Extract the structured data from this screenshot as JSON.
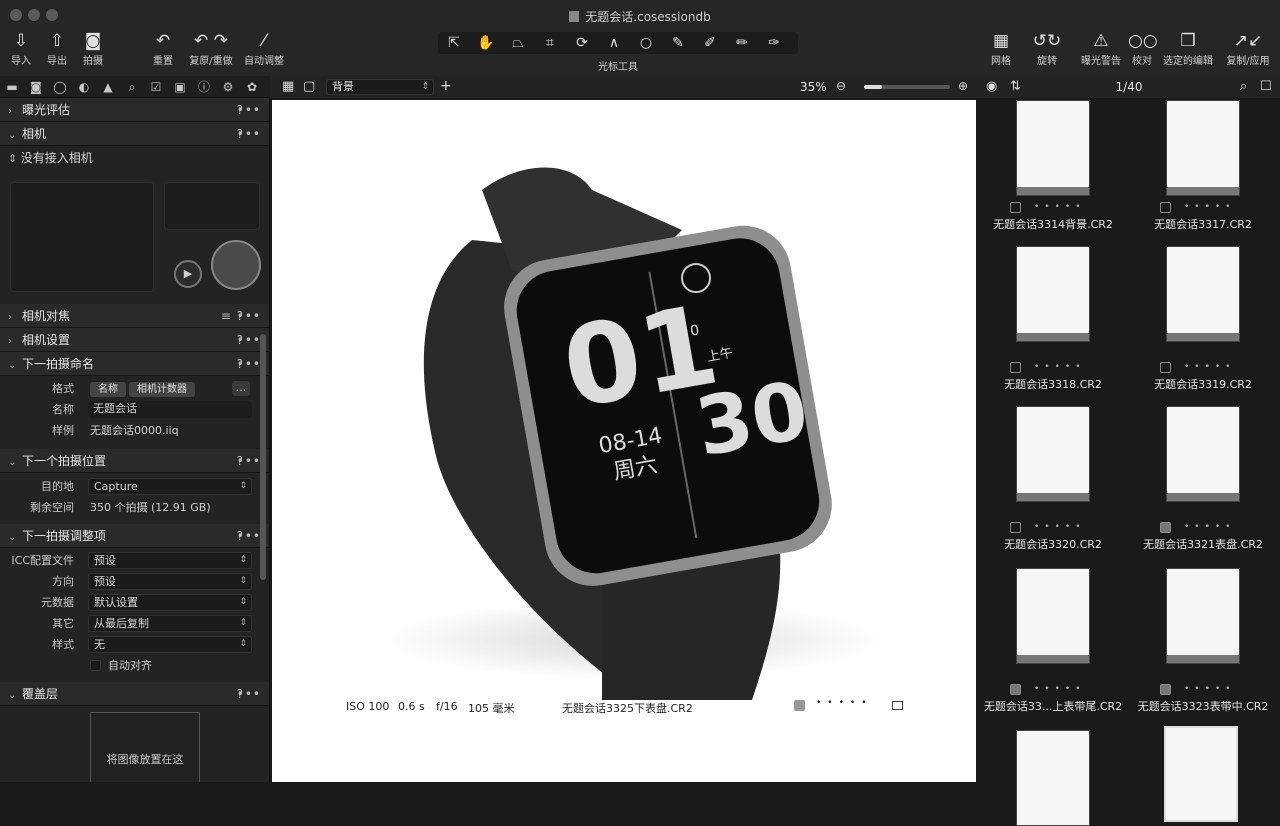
{
  "window": {
    "title": "无题会话.cosessiondb"
  },
  "toolbar": {
    "import_label": "导入",
    "export_label": "导出",
    "capture_label": "拍摄",
    "reset_label": "重置",
    "undo_redo_label": "复原/重做",
    "auto_adjust_label": "自动调整",
    "cursor_tools_label": "光标工具",
    "grid_label": "网格",
    "rotate_label": "旋转",
    "exposure_warning_label": "曝光警告",
    "proof_label": "校对",
    "edit_selected_label": "选定的编辑",
    "copy_apply_label": "复制/应用"
  },
  "viewer": {
    "background_select": "背景",
    "zoom": "35%",
    "metadata": {
      "iso": "ISO 100",
      "shutter": "0.6 s",
      "aperture": "f/16",
      "focal": "105 毫米",
      "filename": "无题会话3325下表盘.CR2"
    }
  },
  "browser": {
    "count": "1/40"
  },
  "left": {
    "exposure_eval": "曝光评估",
    "camera": "相机",
    "no_camera": "没有接入相机",
    "camera_focus": "相机对焦",
    "camera_settings": "相机设置",
    "next_naming": "下一拍摄命名",
    "format_label": "格式",
    "format_chip1": "名称",
    "format_chip2": "相机计数器",
    "name_label": "名称",
    "name_value": "无题会话",
    "sample_label": "样例",
    "sample_value": "无题会话0000.iiq",
    "next_location": "下一个拍摄位置",
    "dest_label": "目的地",
    "dest_value": "Capture",
    "space_label": "剩余空间",
    "space_value": "350 个拍摄 (12.91 GB)",
    "next_adjust": "下一拍摄调整项",
    "icc_label": "ICC配置文件",
    "icc_value": "预设",
    "orient_label": "方向",
    "orient_value": "预设",
    "meta_label": "元数据",
    "meta_value": "默认设置",
    "other_label": "其它",
    "other_value": "从最后复制",
    "style_label": "样式",
    "style_value": "无",
    "auto_align": "自动对齐",
    "overlay": "覆盖层",
    "drop_image": "将图像放置在这"
  },
  "thumbnails": [
    {
      "name": "无题会话3314背景.CR2"
    },
    {
      "name": "无题会话3317.CR2"
    },
    {
      "name": "无题会话3318.CR2"
    },
    {
      "name": "无题会话3319.CR2"
    },
    {
      "name": "无题会话3320.CR2"
    },
    {
      "name": "无题会话3321表盘.CR2"
    },
    {
      "name": "无题会话33...上表带尾.CR2"
    },
    {
      "name": "无题会话3323表带中.CR2"
    }
  ],
  "watch": {
    "hour": "01",
    "minute": "30",
    "date": "08-14",
    "weekday": "周六",
    "ampm": "上午",
    "steps": "0"
  }
}
